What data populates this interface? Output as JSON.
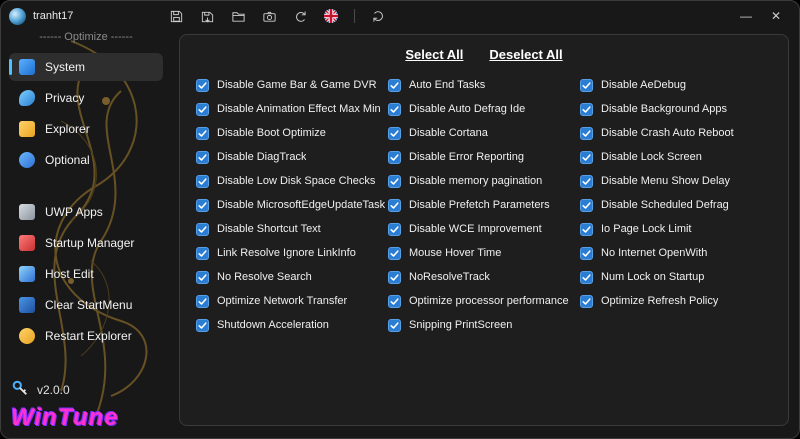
{
  "titlebar": {
    "user": "tranht17",
    "icons": [
      "save",
      "save-as",
      "open-folder",
      "screenshot",
      "undo",
      "language-uk-flag",
      "refresh"
    ],
    "minimize_label": "—",
    "close_label": "✕"
  },
  "sidebar": {
    "section_label": "------ Optimize ------",
    "items": [
      {
        "label": "System",
        "icon": "system-monitor",
        "selected": true
      },
      {
        "label": "Privacy",
        "icon": "privacy"
      },
      {
        "label": "Explorer",
        "icon": "explorer-folder"
      },
      {
        "label": "Optional",
        "icon": "optional"
      },
      {
        "label": "UWP Apps",
        "icon": "uwp-apps",
        "gap": true
      },
      {
        "label": "Startup Manager",
        "icon": "startup-manager"
      },
      {
        "label": "Host Edit",
        "icon": "host-edit"
      },
      {
        "label": "Clear StartMenu",
        "icon": "clear-startmenu"
      },
      {
        "label": "Restart Explorer",
        "icon": "restart-explorer"
      }
    ],
    "version": "v2.0.0",
    "brand": "WinTune"
  },
  "main": {
    "select_all_label": "Select All",
    "deselect_all_label": "Deselect All",
    "checkbox_state": "checked",
    "accent_color": "#2b7cd3",
    "columns": [
      [
        "Disable Game Bar & Game DVR",
        "Disable Animation Effect Max Min",
        "Disable Boot Optimize",
        "Disable DiagTrack",
        "Disable Low Disk Space Checks",
        "Disable MicrosoftEdgeUpdateTask",
        "Disable Shortcut Text",
        "Link Resolve Ignore LinkInfo",
        "No Resolve Search",
        "Optimize Network Transfer",
        "Shutdown Acceleration"
      ],
      [
        "Auto End Tasks",
        "Disable Auto Defrag Ide",
        "Disable Cortana",
        "Disable Error Reporting",
        "Disable memory pagination",
        "Disable Prefetch Parameters",
        "Disable WCE Improvement",
        "Mouse Hover Time",
        "NoResolveTrack",
        "Optimize processor performance",
        "Snipping PrintScreen"
      ],
      [
        "Disable AeDebug",
        "Disable Background Apps",
        "Disable Crash Auto Reboot",
        "Disable Lock Screen",
        "Disable Menu Show Delay",
        "Disable Scheduled Defrag",
        "Io Page Lock Limit",
        "No Internet OpenWith",
        "Num Lock on Startup",
        "Optimize Refresh Policy"
      ]
    ]
  }
}
